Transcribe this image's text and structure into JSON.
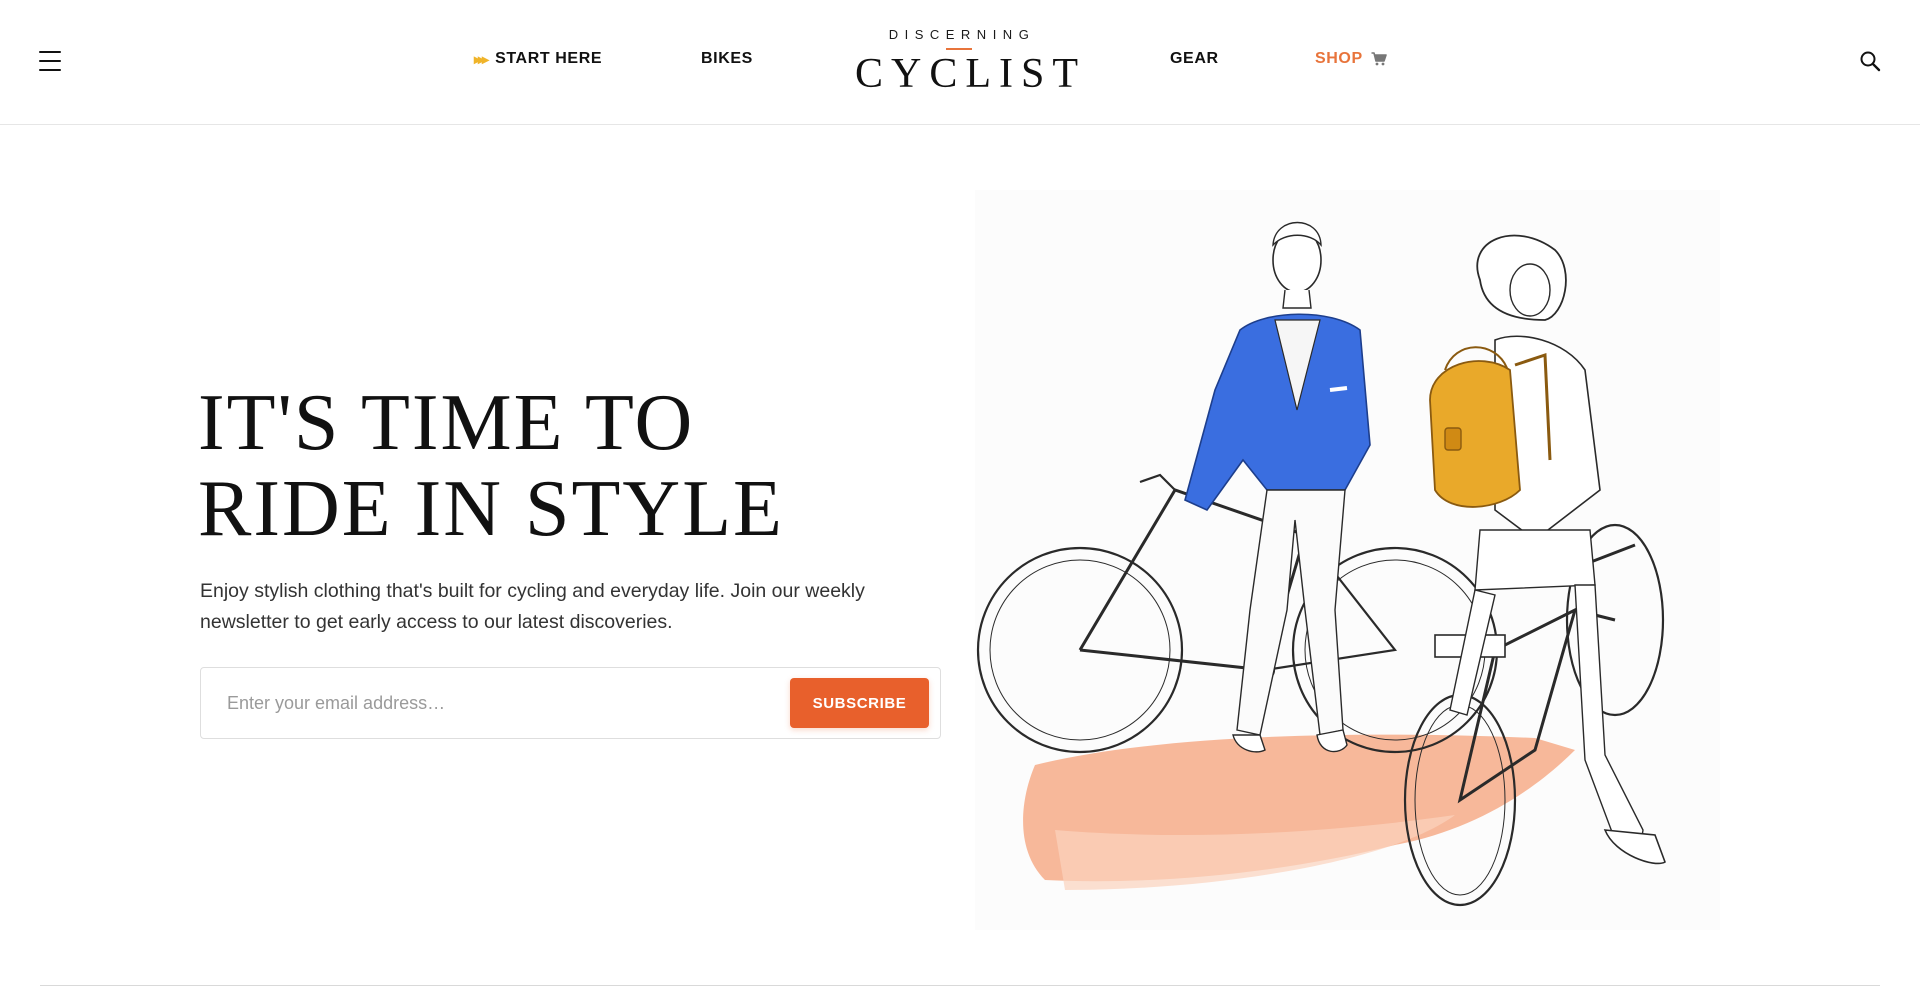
{
  "header": {
    "nav": {
      "start_here": "START HERE",
      "bikes": "BIKES",
      "gear": "GEAR",
      "shop": "SHOP"
    },
    "logo": {
      "top": "DISCERNING",
      "main": "CYCLIST"
    },
    "icons": {
      "menu": "hamburger-menu-icon",
      "start": "triple-chevron-icon",
      "cart": "cart-icon",
      "search": "search-icon"
    }
  },
  "hero": {
    "title_line1": "IT'S TIME TO",
    "title_line2": "RIDE IN STYLE",
    "description": "Enjoy stylish clothing that's built for cycling and everyday life. Join our weekly newsletter to get early access to our latest discoveries.",
    "email_placeholder": "Enter your email address…",
    "email_value": "",
    "subscribe_label": "SUBSCRIBE"
  },
  "colors": {
    "accent": "#e8602c",
    "shop_link": "#e8743b",
    "start_icon": "#f0b429",
    "jacket_blue": "#3a6ee0",
    "backpack_yellow": "#e9a92a",
    "watercolor_orange": "#f5a27a"
  }
}
